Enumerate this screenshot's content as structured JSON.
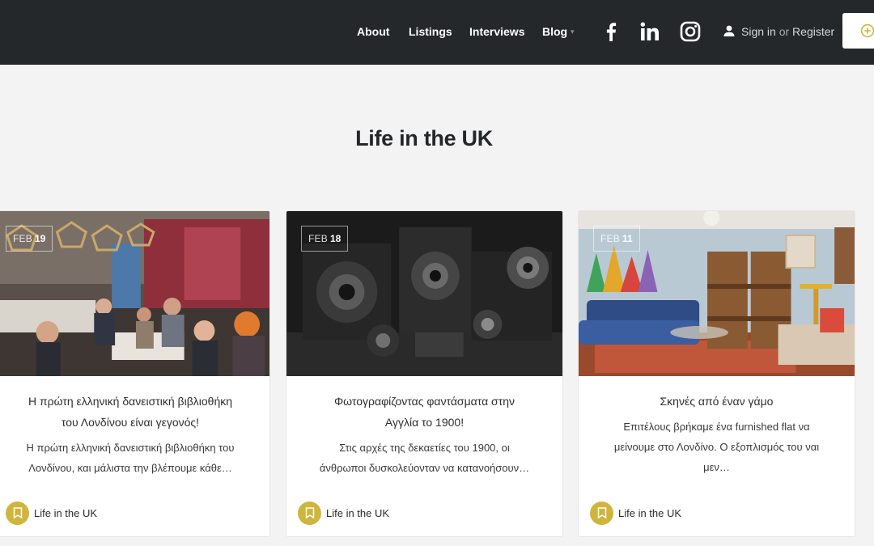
{
  "header": {
    "nav": [
      {
        "label": "About"
      },
      {
        "label": "Listings"
      },
      {
        "label": "Interviews"
      },
      {
        "label": "Blog"
      }
    ],
    "social": [
      "facebook-icon",
      "linkedin-icon",
      "instagram-icon"
    ],
    "sign_in": "Sign in",
    "or": "or",
    "register": "Register",
    "accent": "#cfb53b"
  },
  "section": {
    "title": "Life in the UK"
  },
  "cards": [
    {
      "month": "FEB",
      "day": "19",
      "title_lines": [
        "Η πρώτη ελληνική δανειστική βιβλιοθήκη",
        "του Λονδίνου είναι γεγονός!"
      ],
      "excerpt_lines": [
        "Η πρώτη ελληνική δανειστική βιβλιοθήκη του",
        "Λονδίνου, και μάλιστα την βλέπουμε κάθε…"
      ],
      "category": "Life in the UK"
    },
    {
      "month": "FEB",
      "day": "18",
      "title_lines": [
        "Φωτογραφίζοντας φαντάσματα στην",
        "Αγγλία το 1900!"
      ],
      "excerpt_lines": [
        "Στις αρχές της δεκαετίες του 1900, οι",
        "άνθρωποι δυσκολεύονταν να κατανοήσουν…"
      ],
      "category": "Life in the UK"
    },
    {
      "month": "FEB",
      "day": "11",
      "title_lines": [
        "Σκηνές από έναν γάμο"
      ],
      "excerpt_lines": [
        "Επιτέλους βρήκαμε ένα furnished flat να",
        "μείνουμε στο Λονδίνο. Ο εξοπλισμός του ναι",
        "μεν…"
      ],
      "category": "Life in the UK"
    }
  ]
}
